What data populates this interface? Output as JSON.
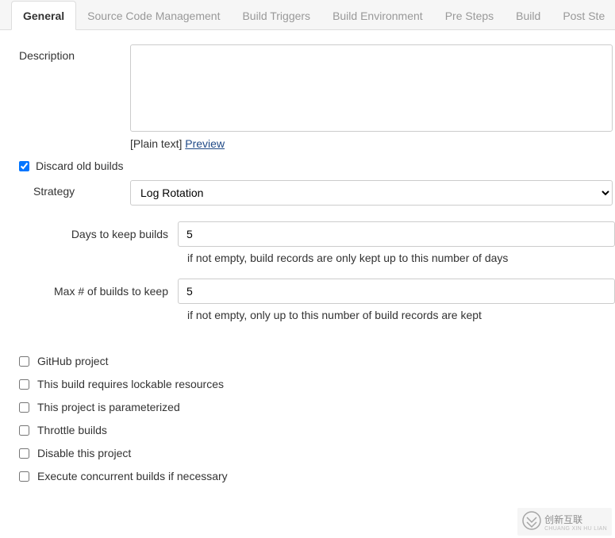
{
  "tabs": {
    "general": "General",
    "scm": "Source Code Management",
    "triggers": "Build Triggers",
    "env": "Build Environment",
    "pre": "Pre Steps",
    "build": "Build",
    "post": "Post Ste"
  },
  "description": {
    "label": "Description",
    "value": "",
    "plain": "[Plain text]",
    "preview": "Preview"
  },
  "discard": {
    "checkbox_label": "Discard old builds",
    "checked": true,
    "strategy_label": "Strategy",
    "strategy_value": "Log Rotation",
    "days_label": "Days to keep builds",
    "days_value": "5",
    "days_help": "if not empty, build records are only kept up to this number of days",
    "max_label": "Max # of builds to keep",
    "max_value": "5",
    "max_help": "if not empty, only up to this number of build records are kept"
  },
  "options": {
    "github_project": "GitHub project",
    "lockable": "This build requires lockable resources",
    "parameterized": "This project is parameterized",
    "throttle": "Throttle builds",
    "disable": "Disable this project",
    "concurrent": "Execute concurrent builds if necessary"
  },
  "watermark": {
    "text": "创新互联",
    "sub": "CHUANG XIN HU LIAN"
  }
}
